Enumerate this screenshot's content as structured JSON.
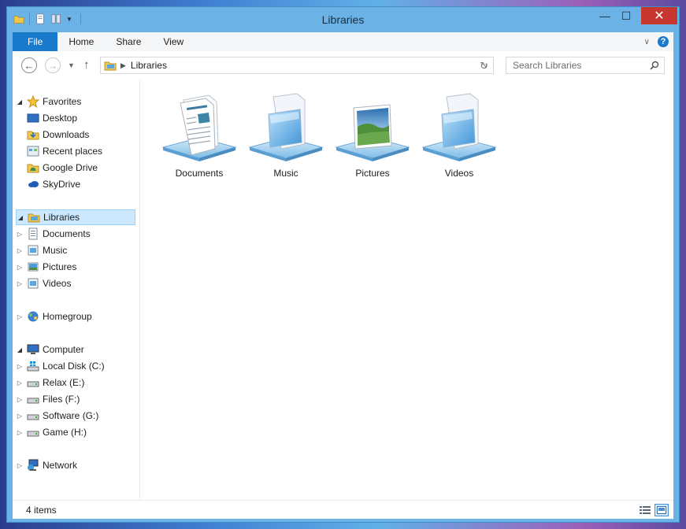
{
  "window": {
    "title": "Libraries"
  },
  "ribbon": {
    "tabs": [
      {
        "label": "File"
      },
      {
        "label": "Home"
      },
      {
        "label": "Share"
      },
      {
        "label": "View"
      }
    ]
  },
  "navigation": {
    "address": {
      "crumb": "Libraries"
    },
    "search": {
      "placeholder": "Search Libraries"
    }
  },
  "sidebar": {
    "favorites": {
      "label": "Favorites",
      "items": [
        {
          "label": "Desktop",
          "icon": "desktop-icon"
        },
        {
          "label": "Downloads",
          "icon": "downloads-icon"
        },
        {
          "label": "Recent places",
          "icon": "recent-places-icon"
        },
        {
          "label": "Google Drive",
          "icon": "google-drive-icon"
        },
        {
          "label": "SkyDrive",
          "icon": "skydrive-icon"
        }
      ]
    },
    "libraries": {
      "label": "Libraries",
      "items": [
        {
          "label": "Documents",
          "icon": "documents-icon"
        },
        {
          "label": "Music",
          "icon": "music-icon"
        },
        {
          "label": "Pictures",
          "icon": "pictures-icon"
        },
        {
          "label": "Videos",
          "icon": "videos-icon"
        }
      ]
    },
    "homegroup": {
      "label": "Homegroup"
    },
    "computer": {
      "label": "Computer",
      "items": [
        {
          "label": "Local Disk (C:)",
          "icon": "local-disk-icon"
        },
        {
          "label": "Relax (E:)",
          "icon": "drive-icon"
        },
        {
          "label": "Files (F:)",
          "icon": "drive-icon"
        },
        {
          "label": "Software (G:)",
          "icon": "drive-icon"
        },
        {
          "label": "Game (H:)",
          "icon": "drive-icon"
        }
      ]
    },
    "network": {
      "label": "Network"
    }
  },
  "content": {
    "libraries": [
      {
        "label": "Documents",
        "icon": "documents-library-icon"
      },
      {
        "label": "Music",
        "icon": "music-library-icon"
      },
      {
        "label": "Pictures",
        "icon": "pictures-library-icon"
      },
      {
        "label": "Videos",
        "icon": "videos-library-icon"
      }
    ]
  },
  "status": {
    "item_count": "4 items"
  },
  "colors": {
    "accent": "#1979ca",
    "selection": "#cce8ff",
    "close": "#c7372f",
    "frame": "#6bb3e6"
  }
}
